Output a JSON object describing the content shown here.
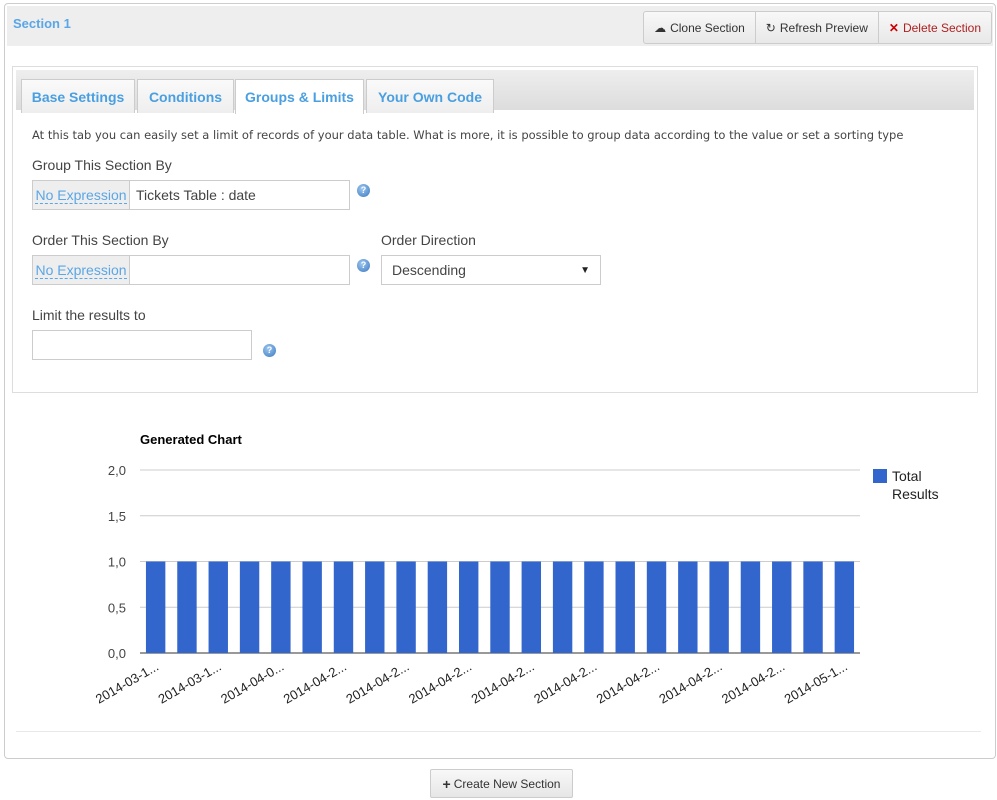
{
  "section": {
    "title": "Section 1",
    "buttons": {
      "clone": "Clone Section",
      "refresh": "Refresh Preview",
      "delete": "Delete Section"
    }
  },
  "tabs": [
    {
      "label": "Base Settings",
      "active": false
    },
    {
      "label": "Conditions",
      "active": false
    },
    {
      "label": "Groups & Limits",
      "active": true
    },
    {
      "label": "Your Own Code",
      "active": false
    }
  ],
  "groups_tab": {
    "description": "At this tab you can easily set a limit of records of your data table. What is more, it is possible to group data according to the value or set a sorting type",
    "group_by": {
      "label": "Group This Section By",
      "expression_link": "No Expression",
      "value": "Tickets Table : date"
    },
    "order_by": {
      "label": "Order This Section By",
      "expression_link": "No Expression",
      "value": ""
    },
    "order_direction": {
      "label": "Order Direction",
      "selected": "Descending"
    },
    "limit": {
      "label": "Limit the results to",
      "value": ""
    },
    "help_glyph": "?"
  },
  "chart_data": {
    "type": "bar",
    "title": "Generated Chart",
    "xlabel": "",
    "ylabel": "",
    "ylim": [
      0,
      2
    ],
    "yticks": [
      "0,0",
      "0,5",
      "1,0",
      "1,5",
      "2,0"
    ],
    "ytick_values": [
      0,
      0.5,
      1.0,
      1.5,
      2.0
    ],
    "grid": true,
    "legend_position": "right",
    "x_tick_labels": [
      "2014-03-1...",
      "2014-03-1...",
      "2014-04-0...",
      "2014-04-2...",
      "2014-04-2...",
      "2014-04-2...",
      "2014-04-2...",
      "2014-04-2...",
      "2014-04-2...",
      "2014-04-2...",
      "2014-04-2...",
      "2014-05-1..."
    ],
    "x_tick_every": 2,
    "series": [
      {
        "name": "Total Results",
        "legend_lines": [
          "Total",
          "Results"
        ],
        "color": "#3366cc",
        "values": [
          1,
          1,
          1,
          1,
          1,
          1,
          1,
          1,
          1,
          1,
          1,
          1,
          1,
          1,
          1,
          1,
          1,
          1,
          1,
          1,
          1,
          1,
          1
        ]
      }
    ]
  },
  "footer": {
    "create_label": "Create New Section"
  }
}
